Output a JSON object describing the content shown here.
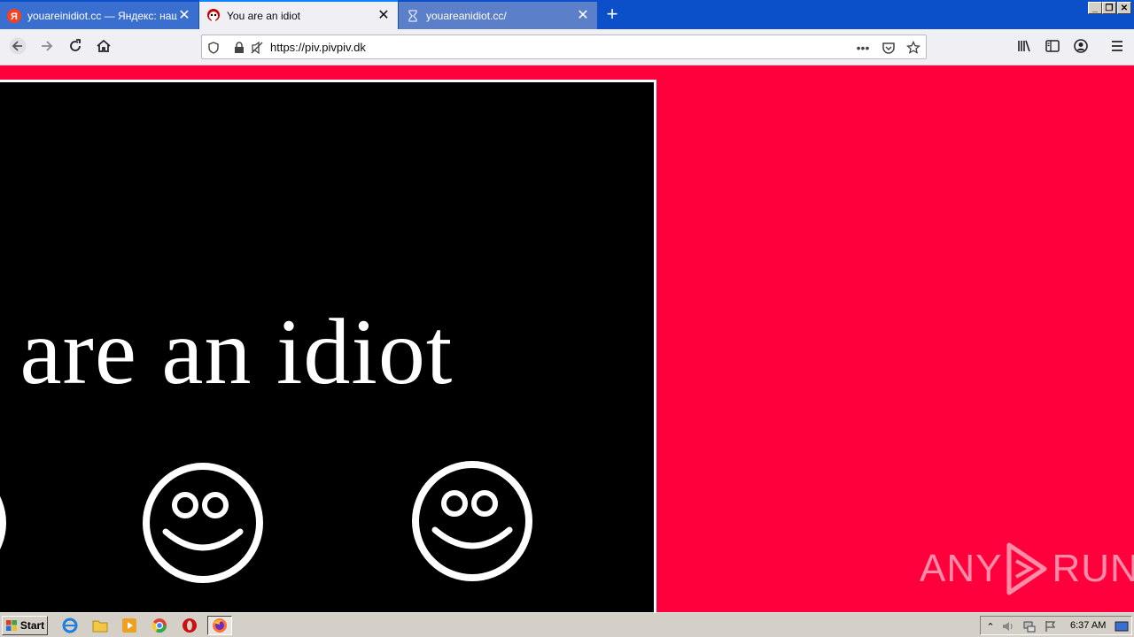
{
  "tabs": [
    {
      "title": "youareinidiot.cc — Яндекс: нашлось",
      "state": "inactive"
    },
    {
      "title": "You are an idiot",
      "state": "active"
    },
    {
      "title": "youareanidiot.cc/",
      "state": "dim"
    }
  ],
  "urlbar": {
    "url": "https://piv.pivpiv.dk"
  },
  "page": {
    "headline": "u are an idiot"
  },
  "watermark": {
    "left": "ANY",
    "right": "RUN"
  },
  "taskbar": {
    "start_label": "Start",
    "clock": "6:37 AM"
  },
  "colors": {
    "page_background": "#ff003c",
    "panel": "#000000",
    "tab_strip": "#0b50c8"
  }
}
